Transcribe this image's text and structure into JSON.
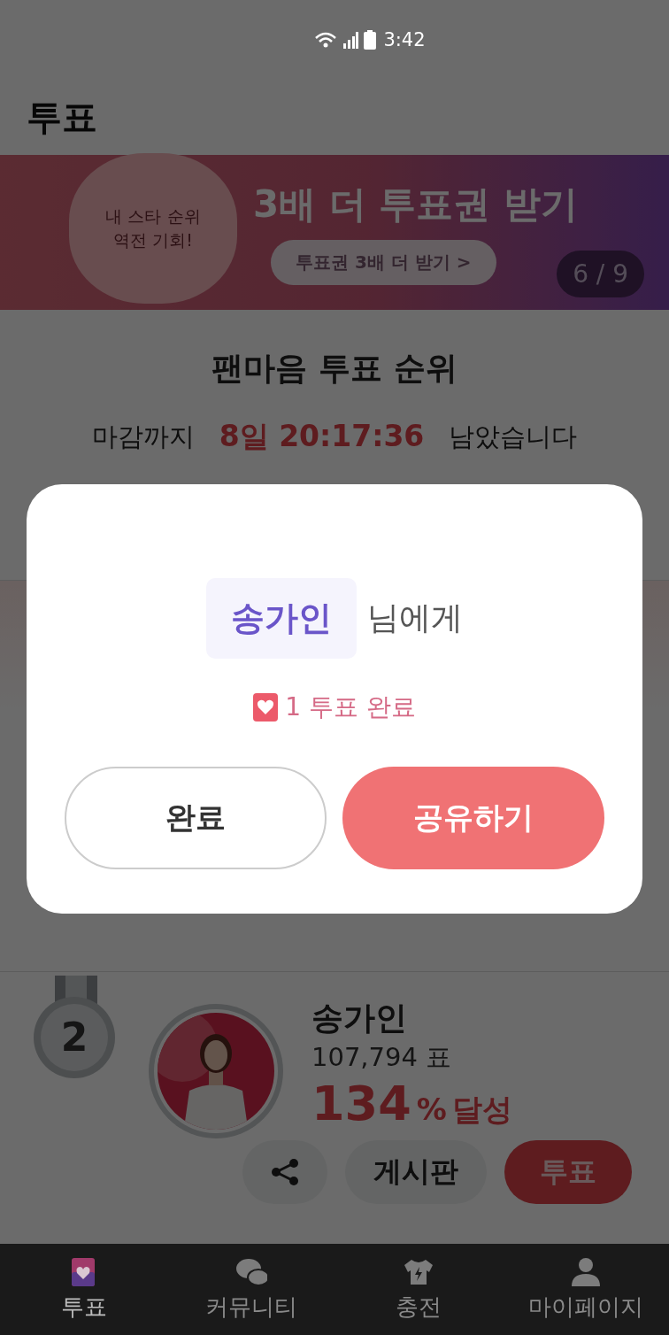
{
  "status_bar": {
    "time": "3:42"
  },
  "header": {
    "title": "투표"
  },
  "banner": {
    "badge_text": "내 스타 순위 역전 기회!",
    "headline": "3배 더 투표권 받기",
    "button": "투표권 3배 더 받기 >",
    "counter": "6 / 9"
  },
  "ranking": {
    "title": "팬마음 투표 순위",
    "countdown_prefix": "마감까지",
    "countdown": "8일 20:17:36",
    "countdown_suffix": "남았습니다"
  },
  "entries": [
    {
      "rank": "2",
      "name": "송가인",
      "votes": "107,794 표",
      "percent": "134",
      "percent_unit": "%",
      "achieved": "달성",
      "actions": {
        "board": "게시판",
        "vote": "투표"
      }
    }
  ],
  "dialog": {
    "recipient": "송가인",
    "recipient_suffix": "님에게",
    "result": "1 투표 완료",
    "buttons": [
      {
        "label": "완료",
        "kind": "secondary"
      },
      {
        "label": "공유하기",
        "kind": "primary"
      }
    ]
  },
  "bottom_nav": [
    {
      "label": "투표",
      "kind": "vote",
      "selected": true
    },
    {
      "label": "커뮤니티",
      "kind": "chat",
      "selected": false
    },
    {
      "label": "충전",
      "kind": "shop",
      "selected": false
    },
    {
      "label": "마이페이지",
      "kind": "profile",
      "selected": false
    }
  ]
}
